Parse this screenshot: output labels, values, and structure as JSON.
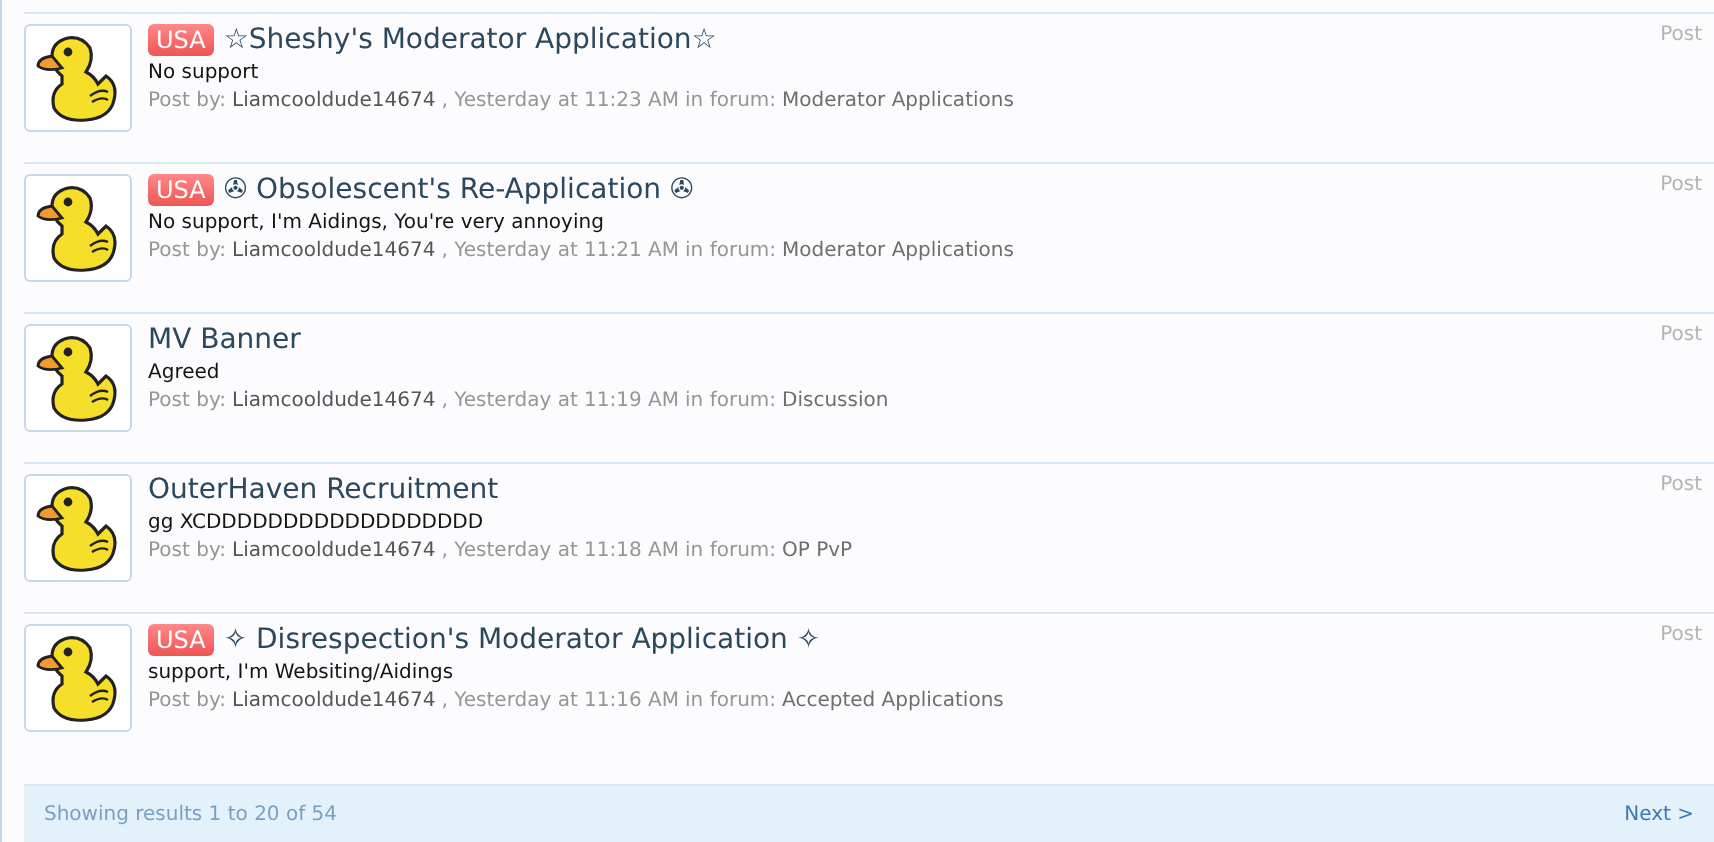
{
  "results": [
    {
      "prefix": "USA",
      "title": "☆Sheshy's Moderator Application☆",
      "snippet": "No support",
      "meta": {
        "label": "Post by:",
        "author": "Liamcooldude14674",
        "time": ", Yesterday at 11:23 AM",
        "in_forum": "in forum:",
        "forum": "Moderator Applications"
      },
      "type": "Post"
    },
    {
      "prefix": "USA",
      "title": "✇ Obsolescent's Re-Application ✇",
      "snippet": "No support, I'm Aidings, You're very annoying",
      "meta": {
        "label": "Post by:",
        "author": "Liamcooldude14674",
        "time": ", Yesterday at 11:21 AM",
        "in_forum": "in forum:",
        "forum": "Moderator Applications"
      },
      "type": "Post"
    },
    {
      "title": "MV Banner",
      "snippet": "Agreed",
      "meta": {
        "label": "Post by:",
        "author": "Liamcooldude14674",
        "time": ", Yesterday at 11:19 AM",
        "in_forum": "in forum:",
        "forum": "Discussion"
      },
      "type": "Post"
    },
    {
      "title": "OuterHaven Recruitment",
      "snippet": "gg XCDDDDDDDDDDDDDDDDDD",
      "meta": {
        "label": "Post by:",
        "author": "Liamcooldude14674",
        "time": ", Yesterday at 11:18 AM",
        "in_forum": "in forum:",
        "forum": "OP PvP"
      },
      "type": "Post"
    },
    {
      "prefix": "USA",
      "title": "✧ Disrespection's Moderator Application ✧",
      "snippet": "support, I'm Websiting/Aidings",
      "meta": {
        "label": "Post by:",
        "author": "Liamcooldude14674",
        "time": ", Yesterday at 11:16 AM",
        "in_forum": "in forum:",
        "forum": "Accepted Applications"
      },
      "type": "Post"
    }
  ],
  "pagination": {
    "summary": "Showing results 1 to 20 of 54",
    "next": "Next >"
  }
}
